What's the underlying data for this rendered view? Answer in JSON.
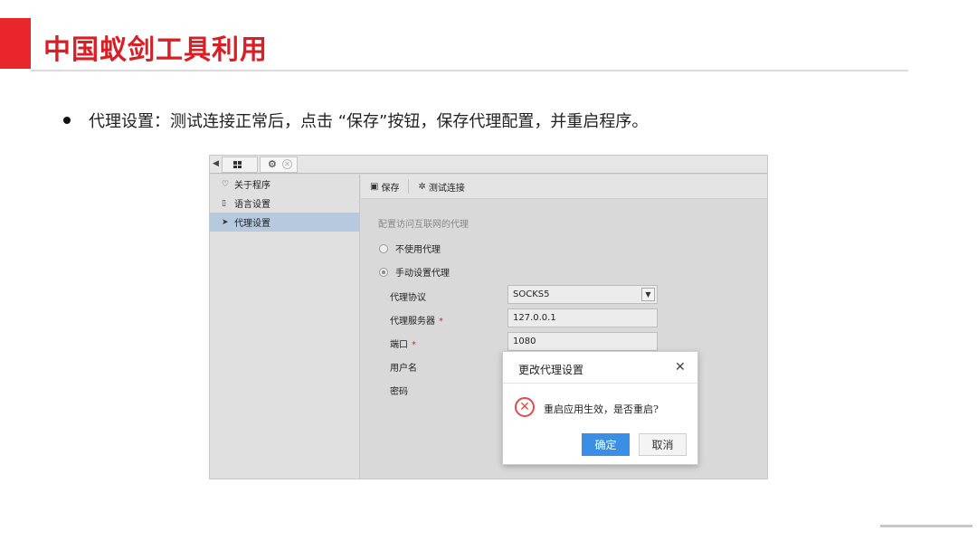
{
  "header": {
    "title": "中国蚁剑工具利用"
  },
  "bullet": {
    "text": "代理设置：测试连接正常后，点击 “保存”按钮，保存代理配置，并重启程序。"
  },
  "app": {
    "sidebar": {
      "items": [
        {
          "icon": "heart-icon",
          "label": "关于程序"
        },
        {
          "icon": "language-icon",
          "label": "语言设置"
        },
        {
          "icon": "send-icon",
          "label": "代理设置"
        }
      ]
    },
    "toolbar": {
      "save_label": "保存",
      "test_label": "测试连接"
    },
    "form": {
      "section_label": "配置访问互联网的代理",
      "radio_none": "不使用代理",
      "radio_manual": "手动设置代理",
      "protocol_label": "代理协议",
      "protocol_value": "SOCKS5",
      "server_label": "代理服务器",
      "server_value": "127.0.0.1",
      "port_label": "端口",
      "port_value": "1080",
      "username_label": "用户名",
      "password_label": "密码",
      "required_mark": "*"
    }
  },
  "dialog": {
    "title": "更改代理设置",
    "message": "重启应用生效，是否重启?",
    "ok_label": "确定",
    "cancel_label": "取消"
  },
  "colors": {
    "brand_red": "#e8262b",
    "active_sidebar": "#b6c9de",
    "ok_button": "#3a8ee6",
    "error": "#e5484d"
  }
}
